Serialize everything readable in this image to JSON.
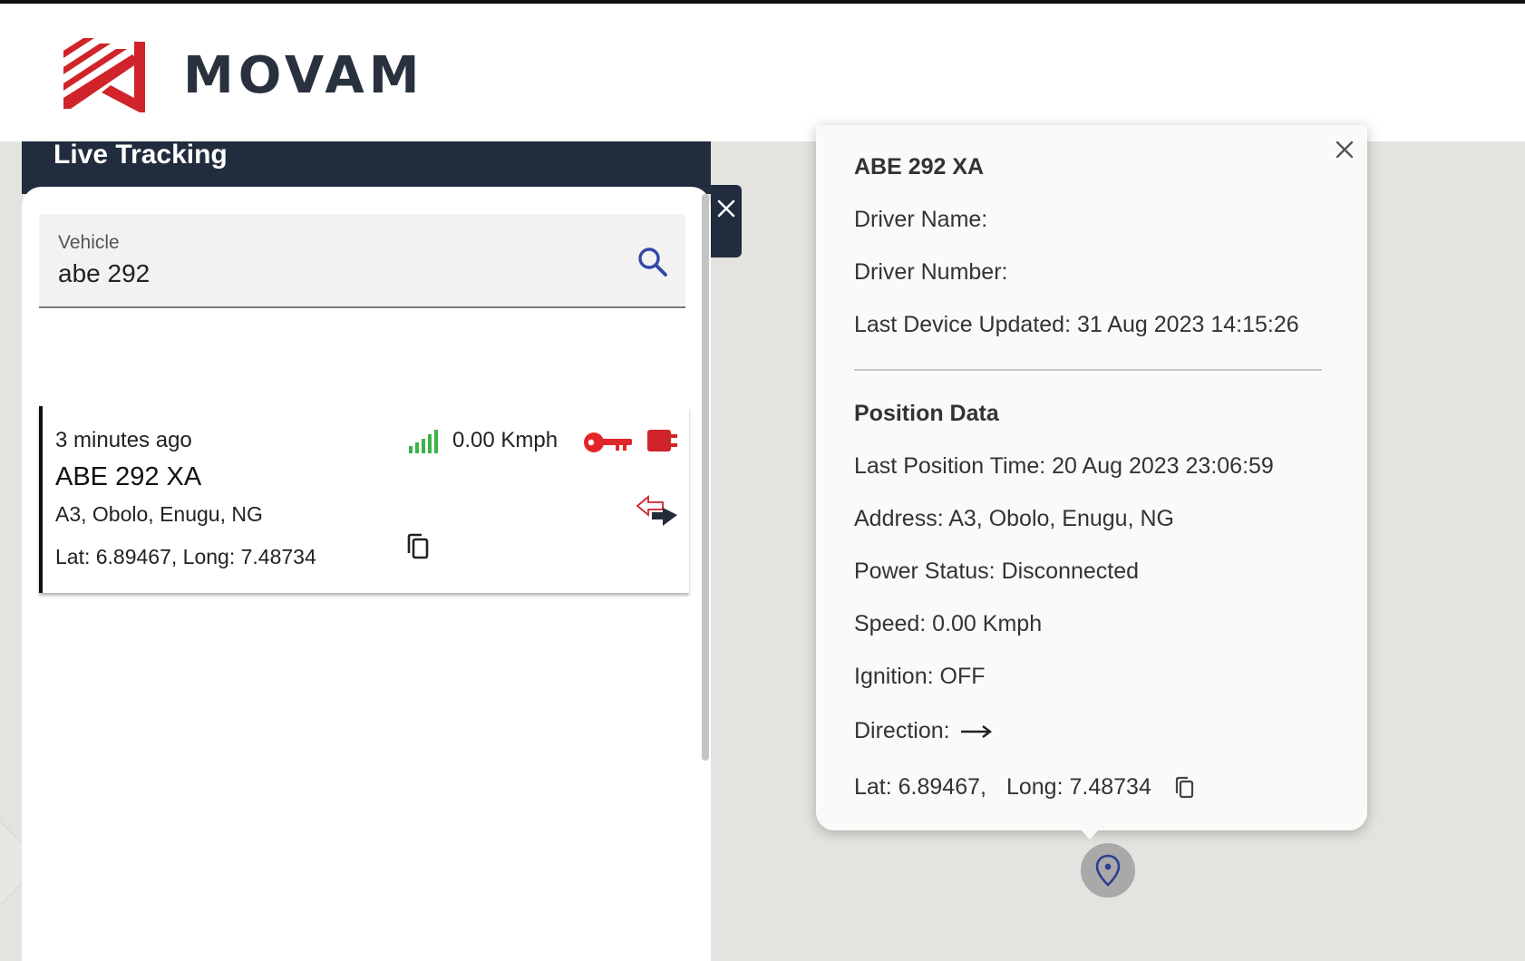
{
  "brand": {
    "name": "MOVAM",
    "colors": {
      "mark": "#d0232a",
      "text": "#28313d",
      "panel_header": "#212d3e"
    }
  },
  "panel": {
    "title": "Live Tracking",
    "search": {
      "label": "Vehicle",
      "value": "abe 292",
      "icon": "search-icon"
    },
    "vehicle": {
      "last_seen": "3 minutes ago",
      "plate": "ABE 292 XA",
      "address": "A3, Obolo, Enugu, NG",
      "lat_long": "Lat: 6.89467, Long: 7.48734",
      "speed": "0.00 Kmph",
      "signal_icon": "signal-bars-icon",
      "ignition_icon": "key-icon",
      "power_icon": "plug-icon",
      "direction_icon": "direction-arrows-icon",
      "copy_icon": "copy-icon"
    }
  },
  "popup": {
    "plate": "ABE 292 XA",
    "driver_name": "Driver Name:",
    "driver_number": "Driver Number:",
    "last_device_updated": "Last Device Updated: 31 Aug 2023 14:15:26",
    "section_title": "Position Data",
    "last_position_time": "Last Position Time: 20 Aug 2023 23:06:59",
    "address": "Address: A3, Obolo, Enugu, NG",
    "power_status": "Power Status: Disconnected",
    "speed": "Speed: 0.00 Kmph",
    "ignition": "Ignition: OFF",
    "direction_label": "Direction:",
    "lat": "Lat: 6.89467,",
    "long": "Long: 7.48734"
  },
  "map": {
    "marker_icon": "location-pin-icon"
  }
}
